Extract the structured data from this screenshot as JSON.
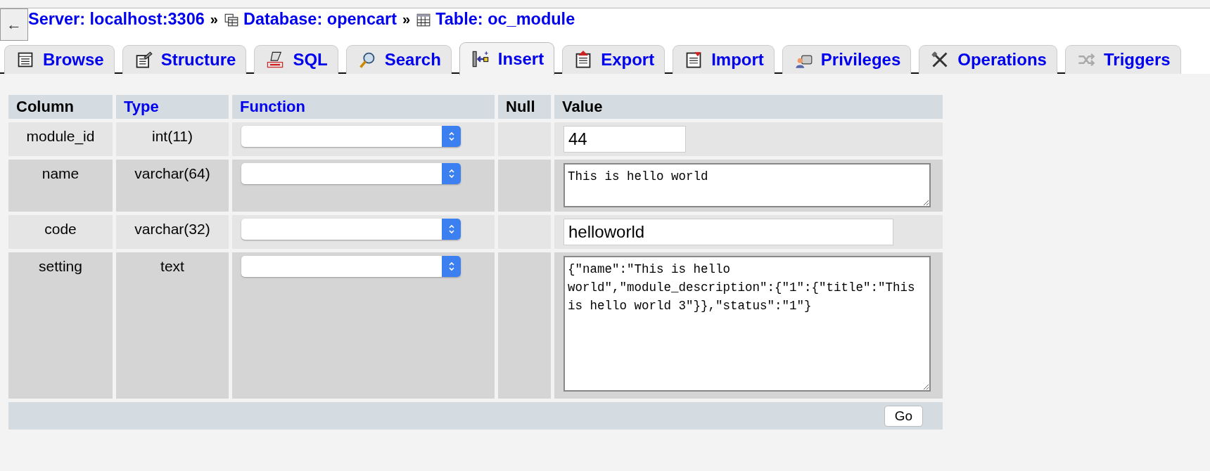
{
  "breadcrumb": [
    {
      "label": "Server: localhost:3306"
    },
    {
      "label": "Database: opencart"
    },
    {
      "label": "Table: oc_module"
    }
  ],
  "separator": "»",
  "back_button": "←",
  "tabs": [
    {
      "label": "Browse",
      "selected": false
    },
    {
      "label": "Structure",
      "selected": false
    },
    {
      "label": "SQL",
      "selected": false
    },
    {
      "label": "Search",
      "selected": false
    },
    {
      "label": "Insert",
      "selected": true
    },
    {
      "label": "Export",
      "selected": false
    },
    {
      "label": "Import",
      "selected": false
    },
    {
      "label": "Privileges",
      "selected": false
    },
    {
      "label": "Operations",
      "selected": false
    },
    {
      "label": "Triggers",
      "selected": false
    }
  ],
  "table": {
    "columns": [
      {
        "label": "Column",
        "kind": "plain"
      },
      {
        "label": "Type",
        "kind": "link"
      },
      {
        "label": "Function",
        "kind": "link"
      },
      {
        "label": "Null",
        "kind": "plain"
      },
      {
        "label": "Value",
        "kind": "plain"
      }
    ],
    "rows": [
      {
        "column": "module_id",
        "type": "int(11)",
        "kind": "short-input",
        "value": "44"
      },
      {
        "column": "name",
        "type": "varchar(64)",
        "kind": "small-textarea",
        "value": "This is hello world"
      },
      {
        "column": "code",
        "type": "varchar(32)",
        "kind": "input",
        "value": "helloworld"
      },
      {
        "column": "setting",
        "type": "text",
        "kind": "large-textarea",
        "value": "{\"name\":\"This is hello world\",\"module_description\":{\"1\":{\"title\":\"This is hello world 3\"}},\"status\":\"1\"}"
      }
    ],
    "submit": "Go"
  }
}
